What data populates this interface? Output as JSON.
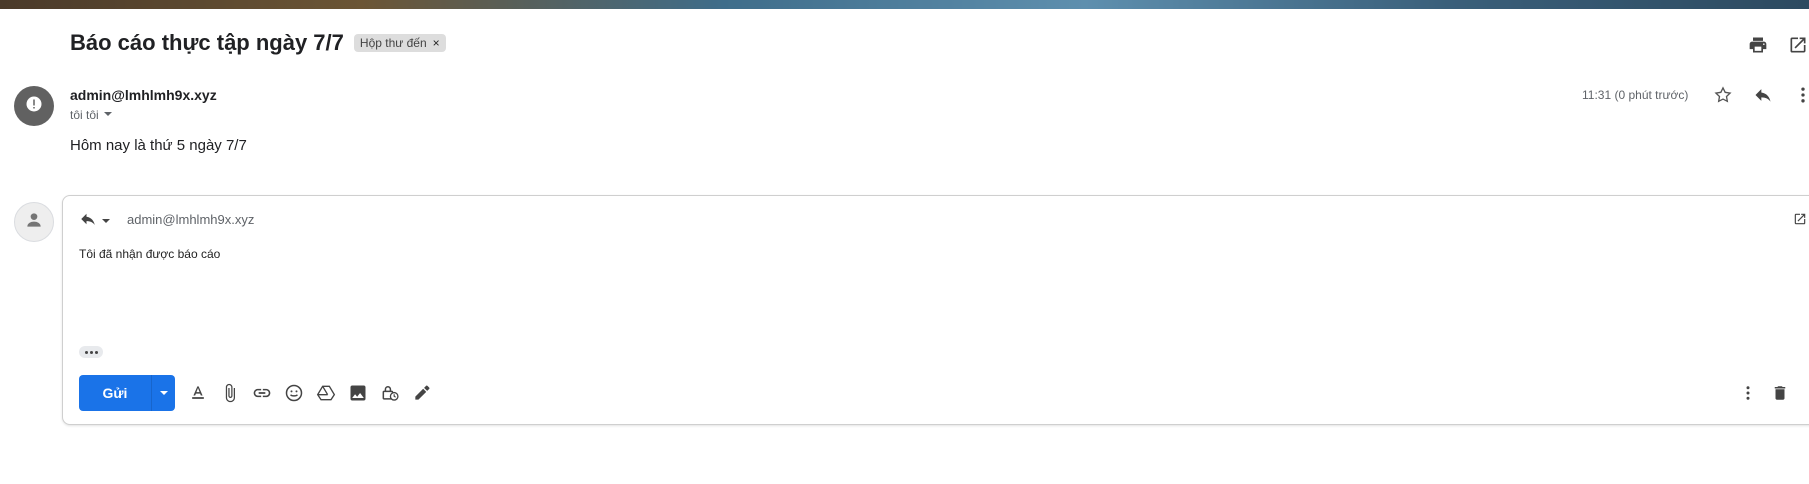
{
  "email": {
    "subject": "Báo cáo thực tập ngày 7/7",
    "label": "Hộp thư đến",
    "label_remove": "×"
  },
  "message": {
    "sender": "admin@lmhlmh9x.xyz",
    "recipient": "tôi tôi",
    "time": "11:31 (0 phút trước)",
    "body": "Hôm nay là thứ 5 ngày 7/7"
  },
  "reply": {
    "to": "admin@lmhlmh9x.xyz",
    "text": "Tôi đã nhận được báo cáo",
    "send_label": "Gửi"
  },
  "colors": {
    "send_button": "#1a73e8",
    "label_chip": "#dddddd",
    "alert_avatar": "#616161"
  },
  "icons": {
    "top": [
      "print-icon",
      "open-in-new-window-icon"
    ],
    "message": [
      "star-icon",
      "reply-icon",
      "more-vert-icon"
    ],
    "toolbar": [
      "format-text-icon",
      "attach-icon",
      "link-icon",
      "emoji-icon",
      "drive-icon",
      "image-icon",
      "confidential-mode-icon",
      "signature-icon"
    ],
    "compose_right": [
      "more-options-icon",
      "discard-icon"
    ]
  }
}
